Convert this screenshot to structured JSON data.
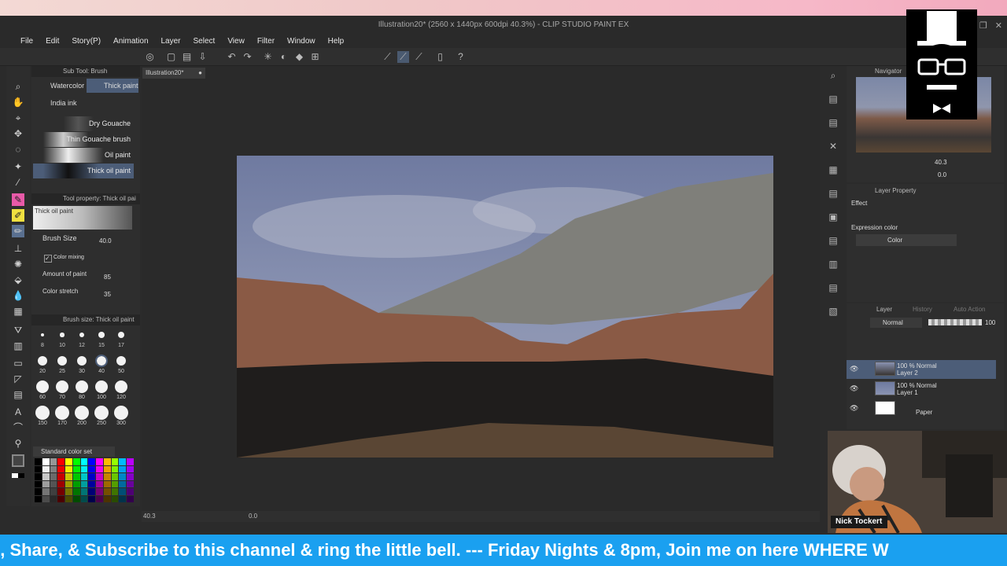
{
  "window": {
    "title": "Illustration20* (2560 x 1440px 600dpi 40.3%)  - CLIP STUDIO PAINT EX"
  },
  "menu": [
    "File",
    "Edit",
    "Story(P)",
    "Animation",
    "Layer",
    "Select",
    "View",
    "Filter",
    "Window",
    "Help"
  ],
  "doc_tab": "Illustration20*",
  "subtool": {
    "header": "Sub Tool: Brush",
    "tabs": [
      "Watercolor",
      "Thick paint",
      "India ink"
    ],
    "brushes": [
      "Dry Gouache",
      "Thin Gouache brush",
      "Oil paint",
      "Thick oil paint"
    ],
    "selected_brush": "Thick oil paint"
  },
  "tool_property": {
    "header": "Tool property: Thick oil pai",
    "preview_label": "Thick oil paint",
    "brush_size_label": "Brush Size",
    "brush_size_value": "40.0",
    "color_mixing_label": "Color mixing",
    "amount_label": "Amount of paint",
    "amount_value": "85",
    "stretch_label": "Color stretch",
    "stretch_value": "35"
  },
  "brush_size_panel": {
    "header": "Brush size: Thick oil paint",
    "sizes_row1": [
      "8",
      "10",
      "12",
      "15",
      "17"
    ],
    "sizes_row2": [
      "20",
      "25",
      "30",
      "40",
      "50"
    ],
    "sizes_row3": [
      "60",
      "70",
      "80",
      "100",
      "120"
    ],
    "sizes_row4": [
      "150",
      "170",
      "200",
      "250",
      "300"
    ],
    "selected": "40"
  },
  "color_set": {
    "label": "Standard color set"
  },
  "navigator": {
    "title": "Navigator",
    "zoom": "40.3",
    "rotation": "0.0"
  },
  "layer_property": {
    "title": "Layer Property",
    "effect_label": "Effect",
    "expression_label": "Expression color",
    "expression_value": "Color"
  },
  "layer_panel": {
    "title": "Layer",
    "tab2": "History",
    "tab3": "Auto Action",
    "blend_mode": "Normal",
    "opacity": "100",
    "layers": [
      {
        "mode": "100 % Normal",
        "name": "Layer 2"
      },
      {
        "mode": "100 % Normal",
        "name": "Layer 1"
      },
      {
        "mode": "",
        "name": "Paper"
      }
    ]
  },
  "statusbar": {
    "zoom": "40.3",
    "angle": "0.0"
  },
  "streamer": {
    "name": "Nick Tockert"
  },
  "ticker": {
    "text": "e, Share, & Subscribe to this channel & ring the little bell. --- Friday Nights & 8pm, Join me on here WHERE W"
  },
  "colors": {
    "ticker_bg": "#1aa0f0",
    "accent_pink": "#e85aa8",
    "sky": "#7c87a8",
    "cliff": "#8a5a45",
    "hill": "#7d7d78"
  }
}
